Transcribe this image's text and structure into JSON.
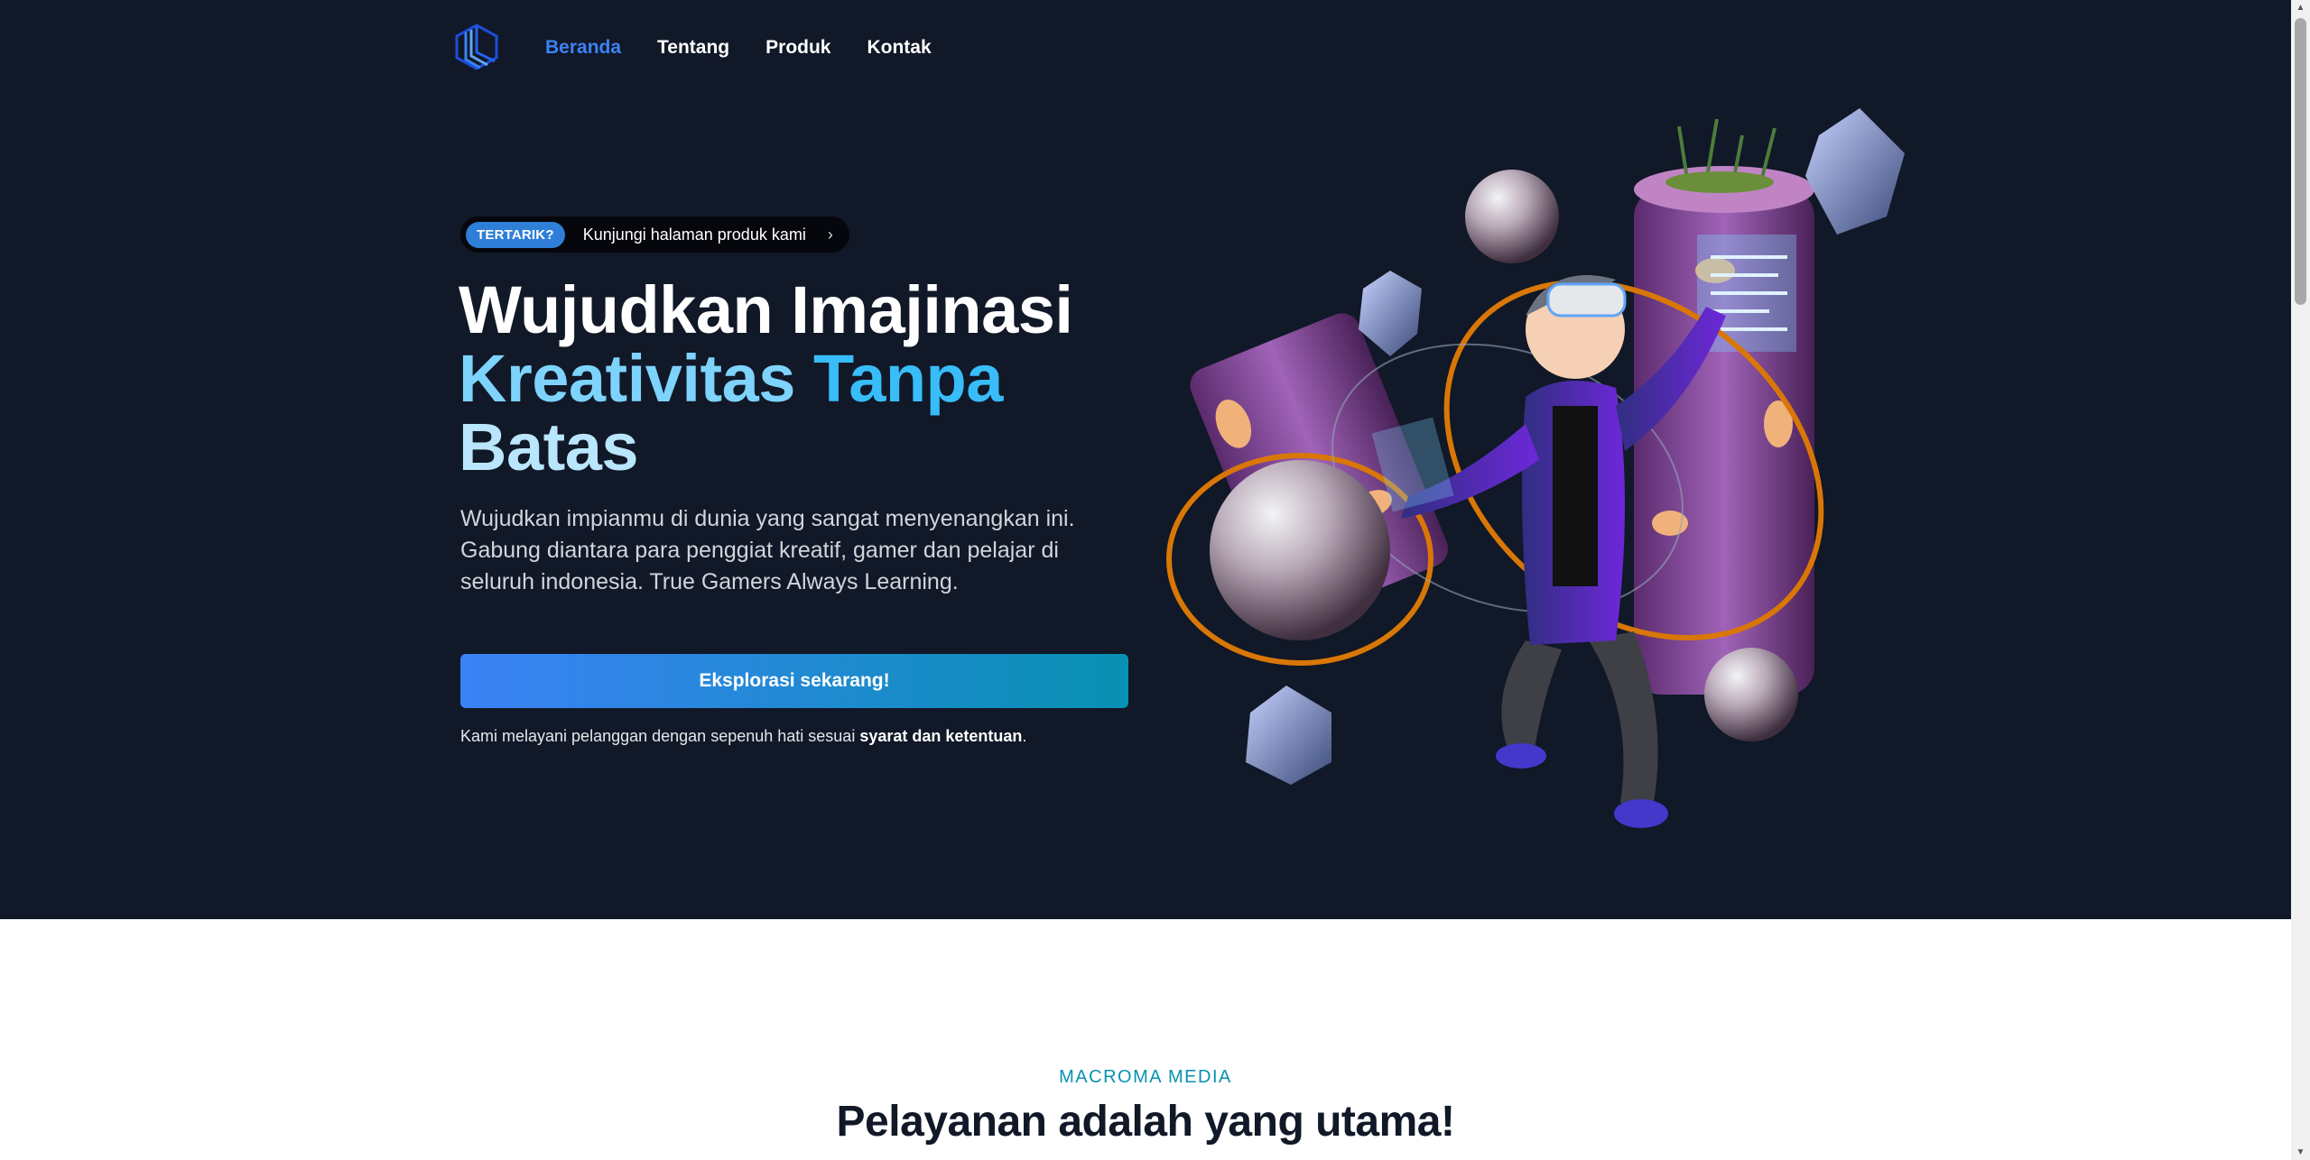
{
  "nav": {
    "logo_icon": "macroma-logo-icon",
    "items": [
      {
        "label": "Beranda",
        "active": true
      },
      {
        "label": "Tentang",
        "active": false
      },
      {
        "label": "Produk",
        "active": false
      },
      {
        "label": "Kontak",
        "active": false
      }
    ]
  },
  "hero": {
    "badge_tag": "TERTARIK?",
    "badge_text": "Kunjungi halaman produk kami",
    "badge_icon": "chevron-right-icon",
    "title_line1": "Wujudkan Imajinasi",
    "title_line2a": "Kreativitas",
    "title_line2b": "Tanpa",
    "title_line3": "Batas",
    "description": "Wujudkan impianmu di dunia yang sangat menyenangkan ini. Gabung diantara para penggiat kreatif, gamer dan pelajar di seluruh indonesia. True Gamers Always Learning.",
    "cta_label": "Eksplorasi sekarang!",
    "terms_prefix": "Kami melayani pelanggan dengan sepenuh hati sesuai ",
    "terms_link": "syarat dan ketentuan",
    "terms_suffix": ".",
    "illustration": "vr-character-3d-illustration"
  },
  "section": {
    "eyebrow": "MACROMA MEDIA",
    "title": "Pelayanan adalah yang utama!"
  },
  "colors": {
    "hero_bg": "#111827",
    "accent_blue": "#3b82f6",
    "accent_cyan": "#0891b2",
    "title_light_blue": "#7dd3fc"
  }
}
